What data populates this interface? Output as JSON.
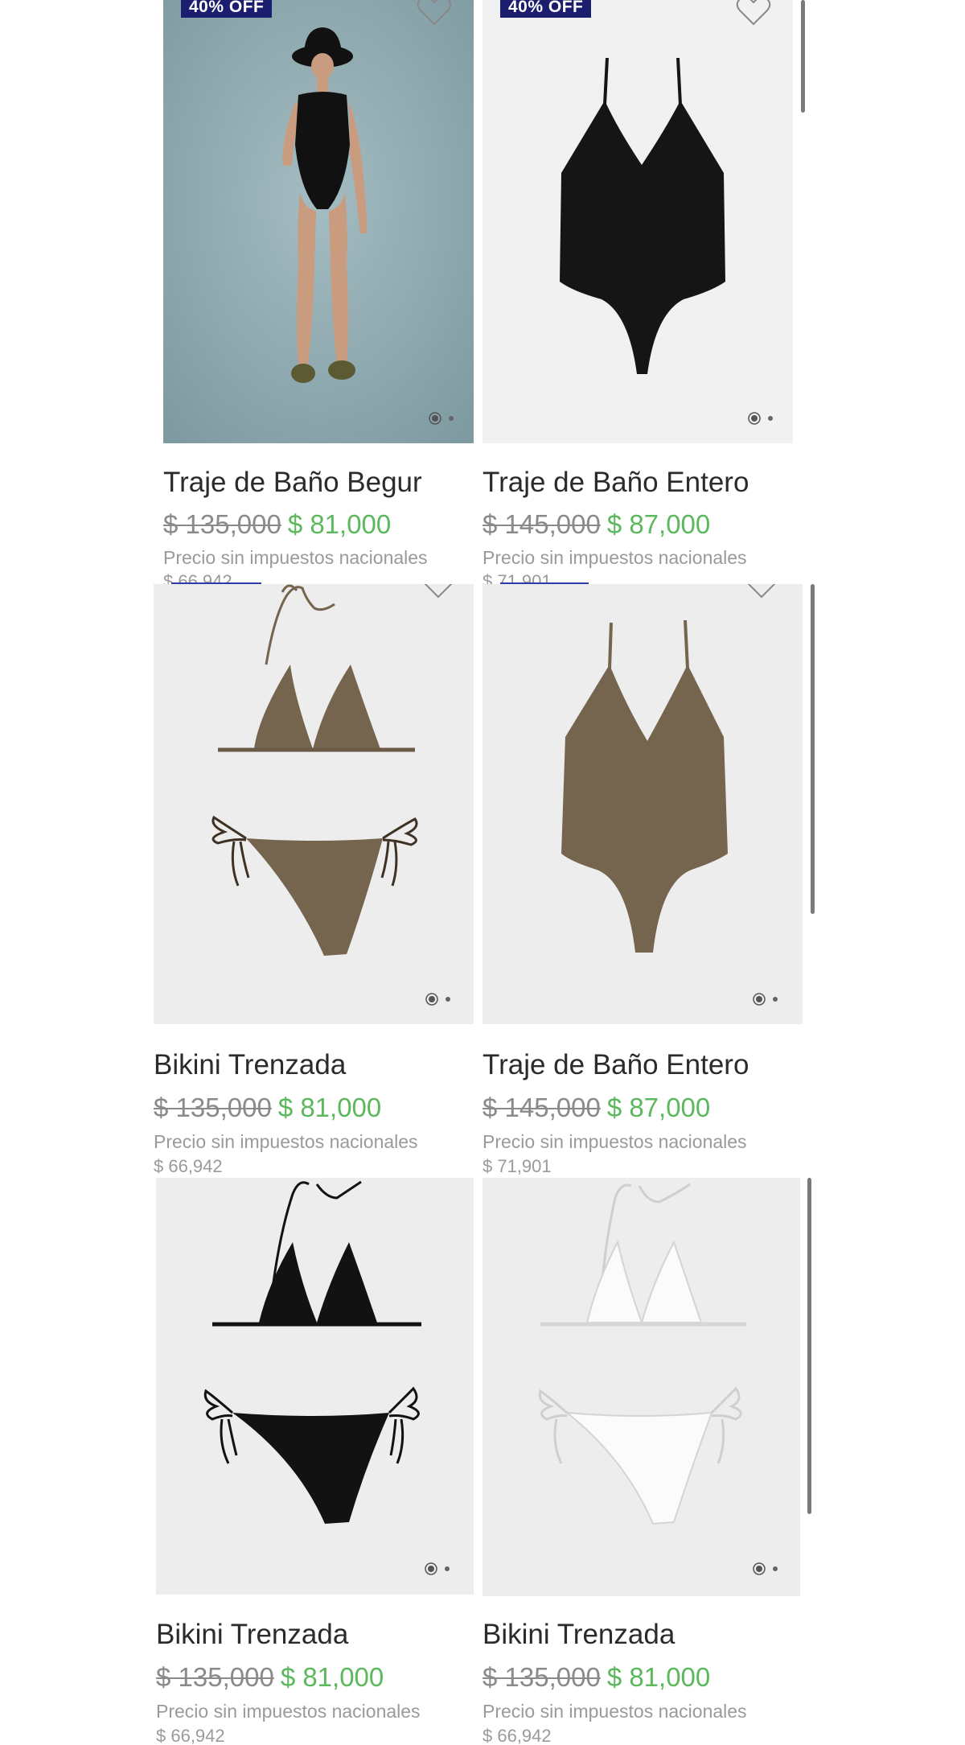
{
  "products": [
    {
      "id": "p1",
      "badge": "40% OFF",
      "title": "Traje de Baño Begur",
      "old_price": "$ 135,000",
      "new_price": "$ 81,000",
      "tax_note": "Precio sin impuestos nacionales",
      "tax_price": "$ 66,942",
      "image": "model-black-swimsuit",
      "colors": {
        "bg": "#8fa9b0",
        "garment": "#111111"
      }
    },
    {
      "id": "p2",
      "badge": "40% OFF",
      "title": "Traje de Baño Entero",
      "old_price": "$ 145,000",
      "new_price": "$ 87,000",
      "tax_note": "Precio sin impuestos nacionales",
      "tax_price": "$ 71,901",
      "image": "black-one-piece",
      "colors": {
        "bg": "#f1f1f1",
        "garment": "#151515"
      }
    },
    {
      "id": "p3",
      "title": "Bikini Trenzada",
      "old_price": "$ 135,000",
      "new_price": "$ 81,000",
      "tax_note": "Precio sin impuestos nacionales",
      "tax_price": "$ 66,942",
      "image": "brown-bikini",
      "colors": {
        "bg": "#ededed",
        "garment": "#75644e"
      }
    },
    {
      "id": "p4",
      "title": "Traje de Baño Entero",
      "old_price": "$ 145,000",
      "new_price": "$ 87,000",
      "tax_note": "Precio sin impuestos nacionales",
      "tax_price": "$ 71,901",
      "image": "brown-one-piece",
      "colors": {
        "bg": "#ededed",
        "garment": "#75644e"
      }
    },
    {
      "id": "p5",
      "title": "Bikini Trenzada",
      "old_price": "$ 135,000",
      "new_price": "$ 81,000",
      "tax_note": "Precio sin impuestos nacionales",
      "tax_price": "$ 66,942",
      "image": "black-bikini",
      "colors": {
        "bg": "#ededed",
        "garment": "#121212"
      }
    },
    {
      "id": "p6",
      "title": "Bikini Trenzada",
      "old_price": "$ 135,000",
      "new_price": "$ 81,000",
      "tax_note": "Precio sin impuestos nacionales",
      "tax_price": "$ 66,942",
      "image": "white-bikini",
      "colors": {
        "bg": "#ededed",
        "garment": "#fbfbfb"
      }
    }
  ],
  "icons": {
    "favorite": "heart-outline-icon",
    "carousel": "carousel-dots-icon"
  },
  "colors": {
    "accent": "#1b1e6e",
    "sale": "#5cb85c",
    "muted": "#8a8a8a"
  }
}
